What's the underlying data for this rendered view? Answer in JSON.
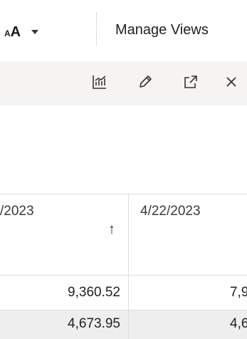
{
  "toolbar": {
    "font_size_label": "A",
    "font_size_prefix": "A",
    "manage_views_label": "Manage Views"
  },
  "panel_header": {
    "icons": [
      "chart-toggle-icon",
      "pencil-icon",
      "expand-icon",
      "close-icon"
    ]
  },
  "table": {
    "columns": [
      {
        "label": "/2023",
        "sorted": "ascending",
        "sort_glyph": "↑"
      },
      {
        "label": "4/22/2023"
      }
    ],
    "rows": [
      {
        "cells": [
          "9,360.52",
          "7,9"
        ]
      },
      {
        "cells": [
          "4,673.95",
          "4,6"
        ]
      }
    ]
  },
  "colors": {
    "panel_header_bg": "#f5f4f2",
    "grid_line": "#dddddd",
    "alt_row_bg": "#eeeeee"
  }
}
